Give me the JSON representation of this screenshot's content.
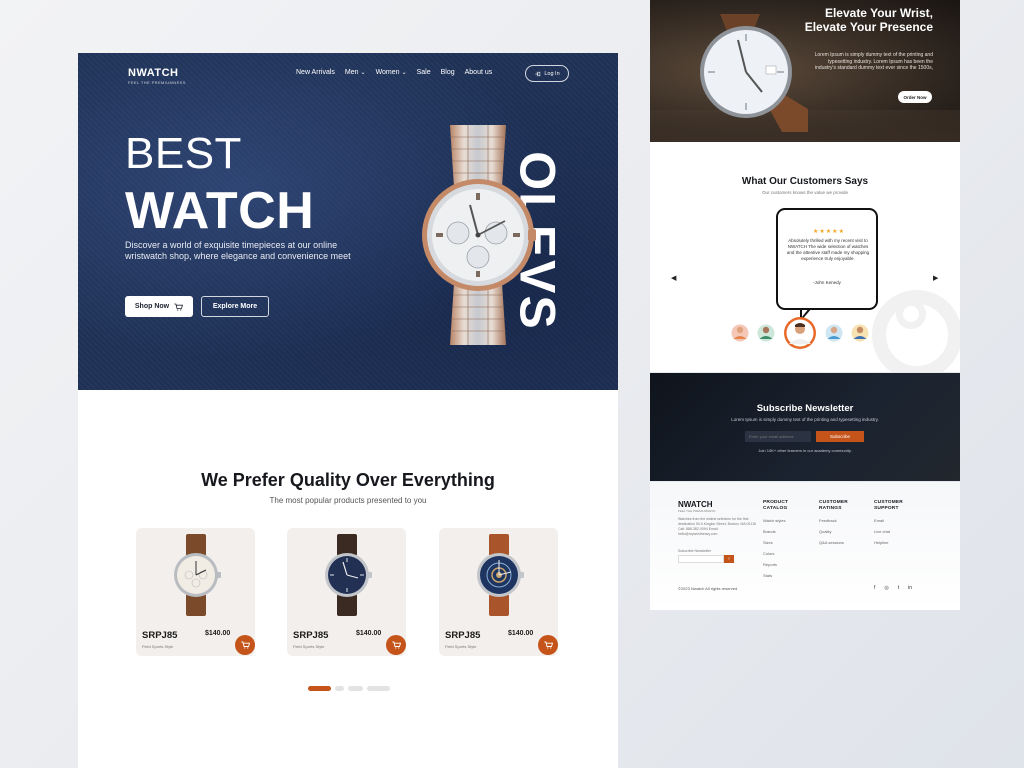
{
  "colors": {
    "accent": "#c4541a",
    "hero_bg": "#1f3257",
    "dark": "#16181d"
  },
  "hero": {
    "brand": "NWATCH",
    "tagline": "FEEL THE PREMIUMNESS",
    "nav": [
      {
        "label": "New Arrivals",
        "has_dropdown": false
      },
      {
        "label": "Men",
        "has_dropdown": true
      },
      {
        "label": "Women",
        "has_dropdown": true
      },
      {
        "label": "Sale",
        "has_dropdown": false
      },
      {
        "label": "Blog",
        "has_dropdown": false
      },
      {
        "label": "About us",
        "has_dropdown": false
      }
    ],
    "login_label": "Log In",
    "title_line1": "BEST",
    "title_line2": "WATCH",
    "description": "Discover a world of exquisite timepieces at our online wristwatch shop, where elegance and convenience meet",
    "shop_label": "Shop Now",
    "explore_label": "Explore More",
    "vertical_word": "OLEVS"
  },
  "products_section": {
    "title": "We Prefer Quality Over Everything",
    "subtitle": "The most popular products presented to you",
    "products": [
      {
        "name": "SRPJ85",
        "price": "$140.00",
        "style": "Field Sports Style",
        "dial": "cream"
      },
      {
        "name": "SRPJ85",
        "price": "$140.00",
        "style": "Field Sports Style",
        "dial": "navy"
      },
      {
        "name": "SRPJ85",
        "price": "$140.00",
        "style": "Field Sports Style",
        "dial": "skeleton-blue"
      }
    ],
    "pagination_active": 0
  },
  "banner": {
    "title": "Elevate Your Wrist, Elevate Your Presence",
    "text": "Lorem Ipsum is simply dummy text of the printing and typesetting industry. Lorem Ipsum has been the industry's standard dummy text ever since the 1500s,",
    "button": "Order Now"
  },
  "testimonials": {
    "title": "What Our Customers Says",
    "subtitle": "Our customers knows the value we provide",
    "rating": "★★★★★",
    "quote": "Absolutely thrilled with my recent visit to NWATCH The wide selection of watches and the attentive staff made my shopping experience truly enjoyable.",
    "author": "-John Kenedy",
    "prev_icon": "left-arrow-icon",
    "next_icon": "right-arrow-icon"
  },
  "newsletter": {
    "title": "Subscribe Newsletter",
    "subtitle": "Lorem Ipsum is simply dummy text of the printing and typesetting industry.",
    "placeholder": "Enter your email address",
    "button": "Subscribe",
    "note": "Join 10K+ other learners in our academy community."
  },
  "footer": {
    "brand": "NWATCH",
    "tagline": "FEEL THE PREMIUMNESS",
    "about": "Watches from the widest selection for the first destination 50 A Kinglon Street, Boston, MA 02116 Call: 888-382-0094 Email: hello@mywristheavy.com",
    "subscribe_label": "Subscribe Newsletter",
    "columns": [
      {
        "heading": "PRODUCT CATALOG",
        "items": [
          "Watch styles",
          "Brands",
          "Sizes",
          "Colors",
          "Reports",
          "Stats"
        ]
      },
      {
        "heading": "CUSTOMER RATINGS",
        "items": [
          "Feedback",
          "Quality",
          "Q&A sessions"
        ]
      },
      {
        "heading": "CUSTOMER SUPPORT",
        "items": [
          "Email",
          "Live chat",
          "Helpline"
        ]
      }
    ],
    "copyright": "©2023 Nwatch All rights reserved",
    "social": [
      "f",
      "◎",
      "t",
      "in"
    ]
  }
}
